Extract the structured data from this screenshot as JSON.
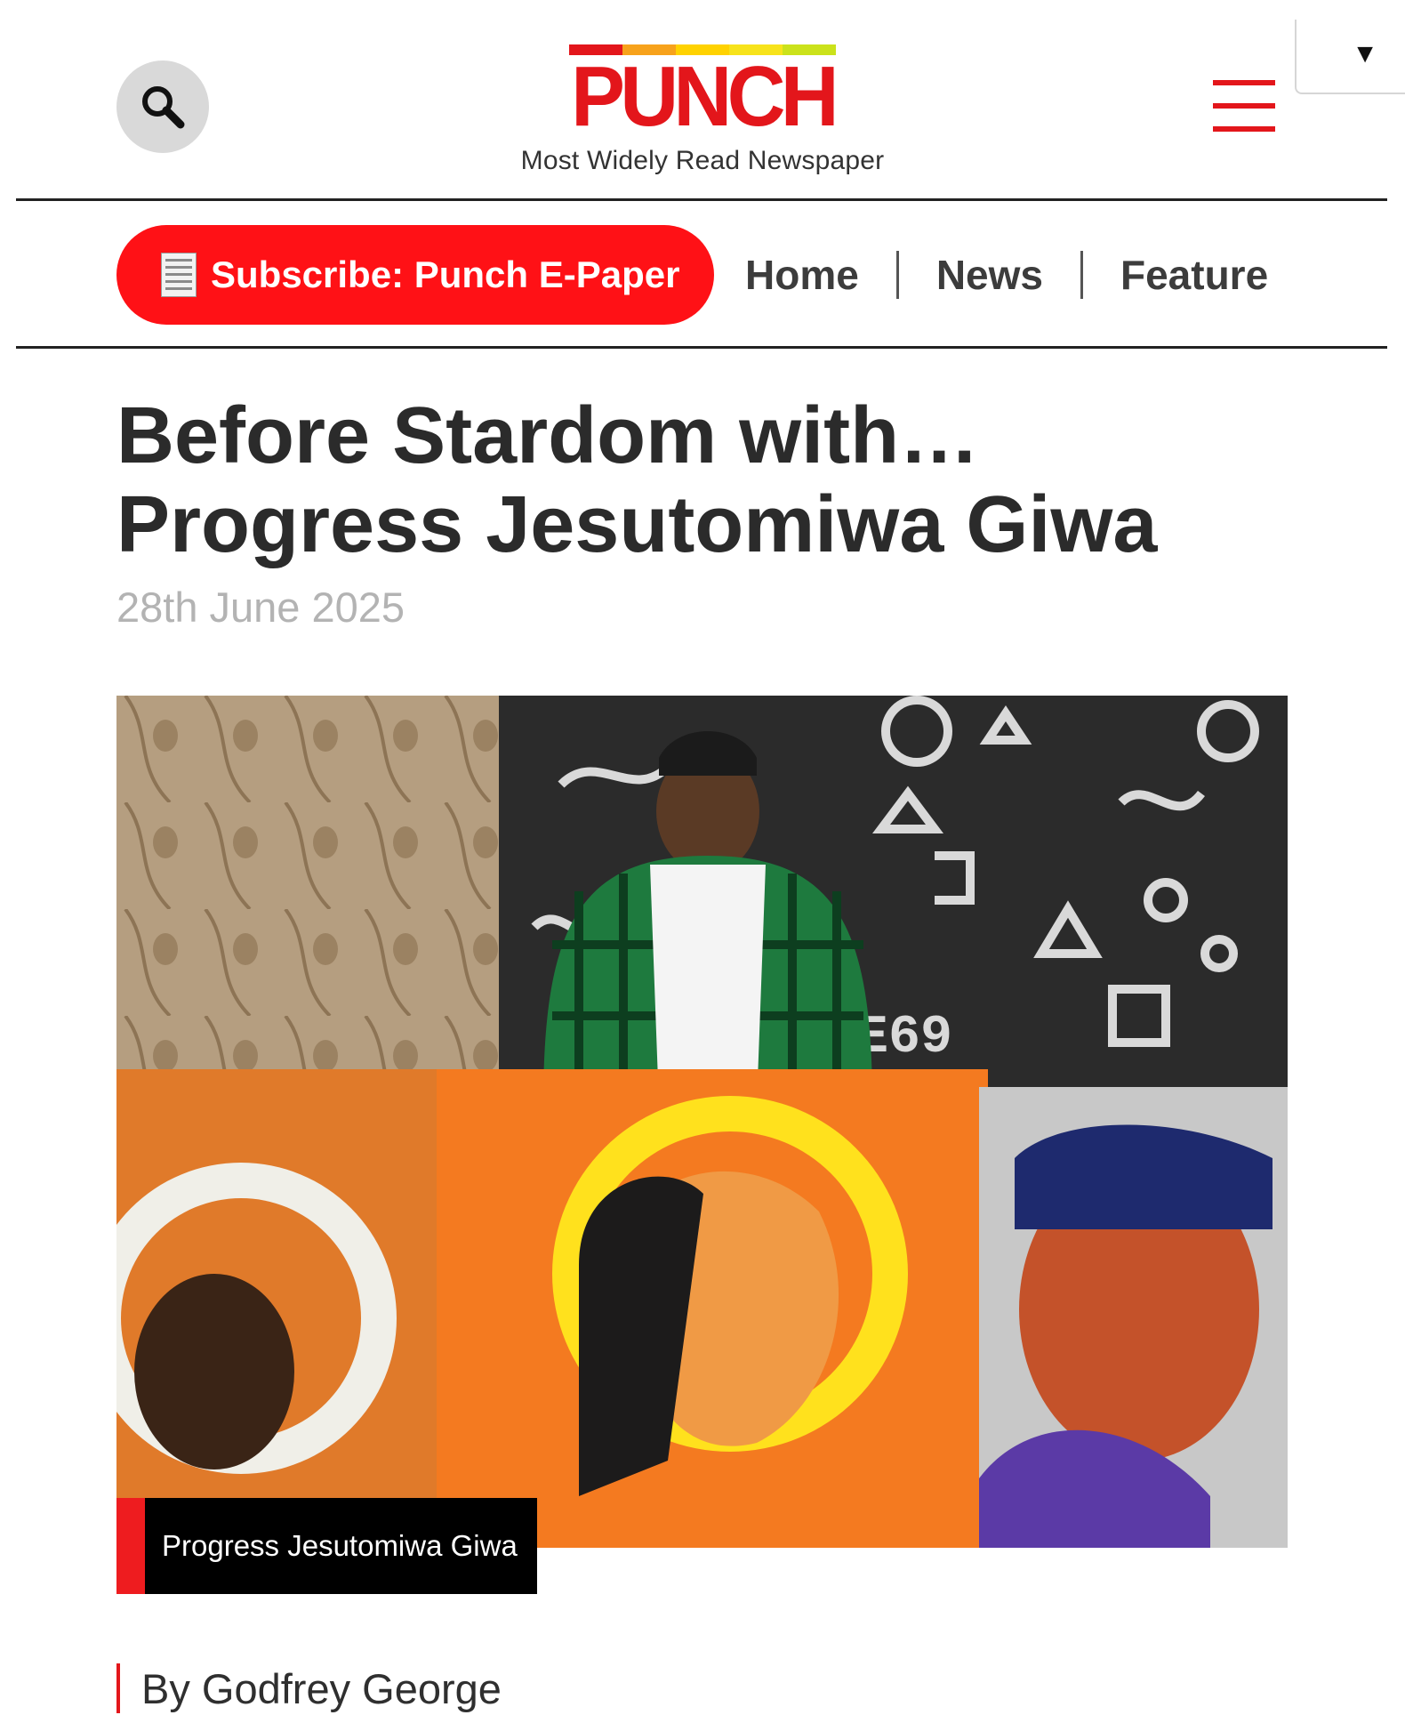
{
  "header": {
    "logo": "PUNCH",
    "tagline": "Most Widely Read Newspaper",
    "brand_red": "#e3161b",
    "logo_bar_colors": [
      "#e3161b",
      "#f7a21b",
      "#ffd200",
      "#f7e31b",
      "#cbe21b"
    ]
  },
  "nav": {
    "subscribe_label": "Subscribe: Punch E-Paper",
    "items": [
      "Home",
      "News",
      "Feature"
    ]
  },
  "article": {
    "title": "Before Stardom with… Progress Jesutomiwa Giwa",
    "date": "28th June 2025",
    "image_caption": "Progress Jesutomiwa Giwa",
    "byline": "By Godfrey George"
  },
  "icons": {
    "search": "search-icon",
    "menu": "hamburger-menu-icon",
    "dropdown": "caret-down-icon",
    "epaper": "newspaper-icon"
  }
}
